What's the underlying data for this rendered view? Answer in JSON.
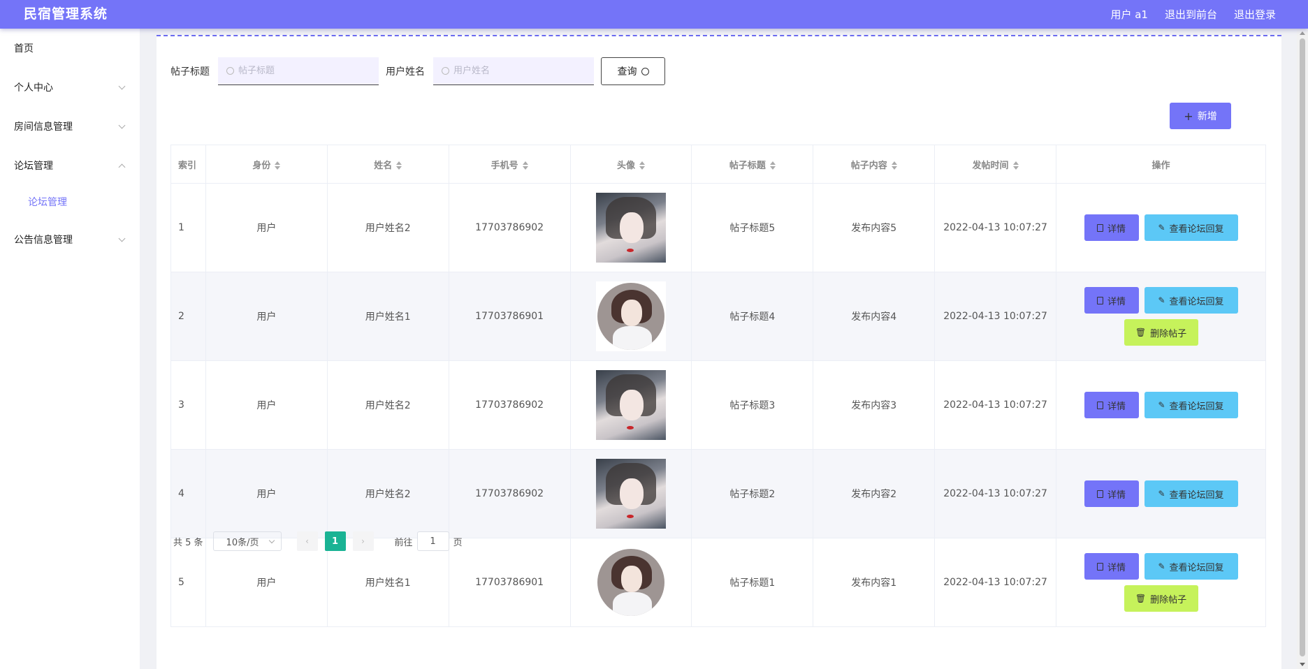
{
  "app": {
    "title": "民宿管理系统"
  },
  "header": {
    "user": "用户 a1",
    "front_label": "退出到前台",
    "logout_label": "退出登录"
  },
  "sidebar": {
    "items": [
      {
        "label": "首页"
      },
      {
        "label": "个人中心"
      },
      {
        "label": "房间信息管理"
      },
      {
        "label": "论坛管理"
      },
      {
        "label": "论坛管理"
      },
      {
        "label": "公告信息管理"
      }
    ]
  },
  "search": {
    "title_label": "帖子标题",
    "title_placeholder": "帖子标题",
    "name_label": "用户姓名",
    "name_placeholder": "用户姓名",
    "query_label": "查询"
  },
  "toolbar": {
    "add_label": "新增"
  },
  "table": {
    "headers": [
      "索引",
      "身份",
      "姓名",
      "手机号",
      "头像",
      "帖子标题",
      "帖子内容",
      "发帖时间",
      "操作"
    ],
    "rows": [
      {
        "index": "1",
        "role": "用户",
        "name": "用户姓名2",
        "phone": "17703786902",
        "avatar": "avatar-photo",
        "title": "帖子标题5",
        "content": "发布内容5",
        "time": "2022-04-13 10:07:27"
      },
      {
        "index": "2",
        "role": "用户",
        "name": "用户姓名1",
        "phone": "17703786901",
        "avatar": "avatar-illustration",
        "title": "帖子标题4",
        "content": "发布内容4",
        "time": "2022-04-13 10:07:27"
      },
      {
        "index": "3",
        "role": "用户",
        "name": "用户姓名2",
        "phone": "17703786902",
        "avatar": "avatar-photo",
        "title": "帖子标题3",
        "content": "发布内容3",
        "time": "2022-04-13 10:07:27"
      },
      {
        "index": "4",
        "role": "用户",
        "name": "用户姓名2",
        "phone": "17703786902",
        "avatar": "avatar-photo",
        "title": "帖子标题2",
        "content": "发布内容2",
        "time": "2022-04-13 10:07:27"
      },
      {
        "index": "5",
        "role": "用户",
        "name": "用户姓名1",
        "phone": "17703786901",
        "avatar": "avatar-illustration",
        "title": "帖子标题1",
        "content": "发布内容1",
        "time": "2022-04-13 10:07:27"
      }
    ],
    "actions": {
      "detail": "详情",
      "reply": "查看论坛回复",
      "delete": "删除帖子"
    }
  },
  "pagination": {
    "total": "共 5 条",
    "page_size": "10条/页",
    "current_page": "1",
    "goto_prefix": "前往",
    "goto_value": "1",
    "goto_suffix": "页"
  },
  "colors": {
    "primary": "#7474f8",
    "reply": "#5cc8f6",
    "delete": "#c6f25b",
    "page_active": "#1ab394"
  }
}
